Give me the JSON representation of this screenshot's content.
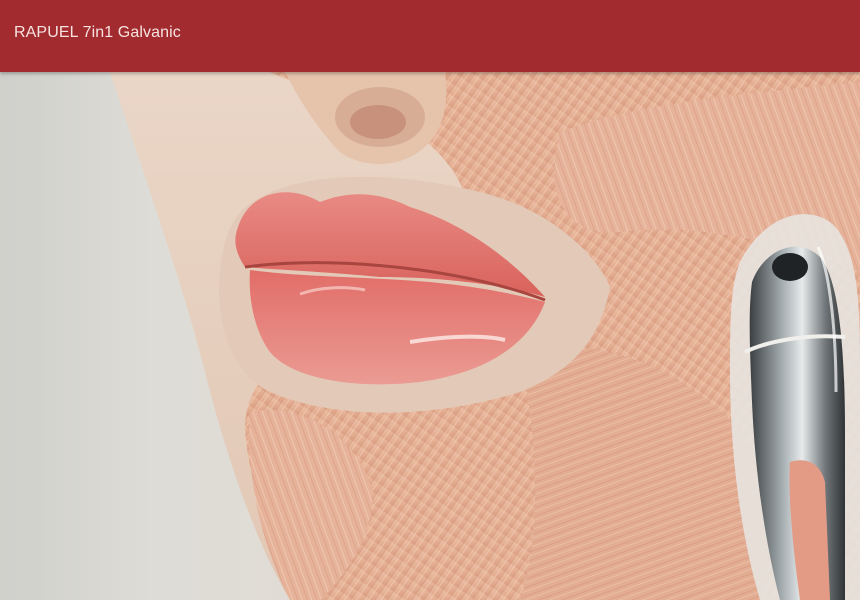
{
  "header": {
    "title": "RAPUEL 7in1 Galvanic",
    "background_color": "#a22b30",
    "title_color": "#f6e3e0"
  },
  "hero": {
    "image_subject": "lips-facial-muscle-device-illustration",
    "device_icon": "galvanic-device-icon"
  }
}
